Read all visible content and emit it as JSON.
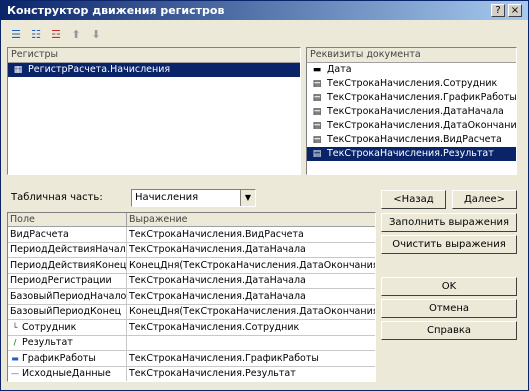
{
  "window": {
    "title": "Конструктор движения регистров"
  },
  "registers_panel": {
    "header": "Регистры",
    "items": [
      {
        "label": "РегистрРасчета.Начисления"
      }
    ]
  },
  "requisites_panel": {
    "header": "Реквизиты документа",
    "items": [
      {
        "label": "Дата",
        "icon": "dash-icon"
      },
      {
        "label": "ТекСтрокаНачисления.Сотрудник",
        "icon": "table-icon"
      },
      {
        "label": "ТекСтрокаНачисления.ГрафикРаботы",
        "icon": "table-icon"
      },
      {
        "label": "ТекСтрокаНачисления.ДатаНачала",
        "icon": "table-icon"
      },
      {
        "label": "ТекСтрокаНачисления.ДатаОкончания",
        "icon": "table-icon"
      },
      {
        "label": "ТекСтрокаНачисления.ВидРасчета",
        "icon": "table-icon"
      },
      {
        "label": "ТекСтрокаНачисления.Результат",
        "icon": "table-icon"
      }
    ]
  },
  "tabular_part": {
    "label": "Табличная часть:",
    "value": "Начисления"
  },
  "buttons": {
    "back": "<Назад",
    "next": "Далее>",
    "fill_expressions": "Заполнить выражения",
    "clear_expressions": "Очистить выражения",
    "ok": "OK",
    "cancel": "Отмена",
    "help": "Справка"
  },
  "grid": {
    "columns": [
      "Поле",
      "Выражение"
    ],
    "rows": [
      {
        "field": "ВидРасчета",
        "expr": "ТекСтрокаНачисления.ВидРасчета",
        "icon": ""
      },
      {
        "field": "ПериодДействияНачало",
        "expr": "ТекСтрокаНачисления.ДатаНачала",
        "icon": ""
      },
      {
        "field": "ПериодДействияКонец",
        "expr": "КонецДня(ТекСтрокаНачисления.ДатаОкончания)",
        "icon": ""
      },
      {
        "field": "ПериодРегистрации",
        "expr": "ТекСтрокаНачисления.ДатаНачала",
        "icon": ""
      },
      {
        "field": "БазовыйПериодНачало",
        "expr": "ТекСтрокаНачисления.ДатаНачала",
        "icon": ""
      },
      {
        "field": "БазовыйПериодКонец",
        "expr": "КонецДня(ТекСтрокаНачисления.ДатаОкончания)",
        "icon": ""
      },
      {
        "field": "Сотрудник",
        "expr": "ТекСтрокаНачисления.Сотрудник",
        "icon": "└"
      },
      {
        "field": "Результат",
        "expr": "",
        "icon": "/"
      },
      {
        "field": "ГрафикРаботы",
        "expr": "ТекСтрокаНачисления.ГрафикРаботы",
        "icon": "▬"
      },
      {
        "field": "ИсходныеДанные",
        "expr": "ТекСтрокаНачисления.Результат",
        "icon": "—"
      }
    ]
  }
}
